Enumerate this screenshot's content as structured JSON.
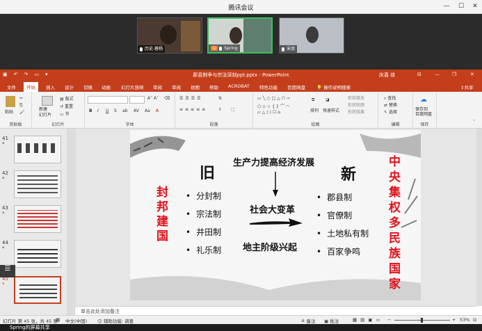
{
  "meeting": {
    "title": "腾讯会议",
    "participants": [
      {
        "name": "历史-蓉杨"
      },
      {
        "name": "Spring"
      },
      {
        "name": "宋旭"
      }
    ]
  },
  "ppt": {
    "doc_title": "郡县制争与宗法深刻ppt.pptx - PowerPoint",
    "user": "庆喜 徐",
    "tabs": [
      "文件",
      "开始",
      "插入",
      "设计",
      "切换",
      "动画",
      "幻灯片放映",
      "审阅",
      "审阅",
      "视图",
      "帮助",
      "ACROBAT",
      "特色功能",
      "百度网盘",
      "操作说明搜索"
    ],
    "share": "共享",
    "ribbon_groups": {
      "clipboard": "剪贴板",
      "slides": "幻灯片",
      "font": "字体",
      "paragraph": "段落",
      "drawing": "绘图",
      "editing": "编辑",
      "save": "保存"
    },
    "ribbon_items": {
      "paste": "粘贴",
      "new_slide": "新建\n幻灯片",
      "layout": "版式",
      "reset": "重置",
      "section": "节",
      "arrange": "排列",
      "quick_styles": "快速样式",
      "shape_fill": "形状填充",
      "shape_outline": "形状轮廓",
      "shape_effects": "形状效果",
      "find": "查找",
      "replace": "替换",
      "select": "选择",
      "save_to_baidu": "保存到\n百度网盘"
    },
    "thumbnails": [
      {
        "num": "41",
        "star": "*"
      },
      {
        "num": "42",
        "star": "*"
      },
      {
        "num": "43",
        "star": "*"
      },
      {
        "num": "44",
        "star": "*"
      },
      {
        "num": "45",
        "star": "*"
      }
    ],
    "notes_placeholder": "单击此处添加备注",
    "status": {
      "slide_info": "幻灯片 第 45 张，共 45 张",
      "lang": "中文(中国)",
      "accessibility": "辅助功能: 调查",
      "notes": "备注",
      "comments": "批注",
      "zoom": "53%"
    },
    "taskbar_text": "Spring的屏幕共享"
  },
  "slide": {
    "left_heading": "旧",
    "right_heading": "新",
    "left_vertical": "封邦建国",
    "right_vertical": "中央集权多民族国家",
    "center_top": "生产力提高经济发展",
    "center_mid": "社会大变革",
    "center_bottom": "地主阶级兴起",
    "left_items": [
      "分封制",
      "宗法制",
      "井田制",
      "礼乐制"
    ],
    "right_items": [
      "郡县制",
      "官僚制",
      "土地私有制",
      "百家争鸣"
    ]
  },
  "colors": {
    "accent": "#c43e1c",
    "red_text": "#e0111b",
    "active_tile": "#3fbf5f"
  }
}
